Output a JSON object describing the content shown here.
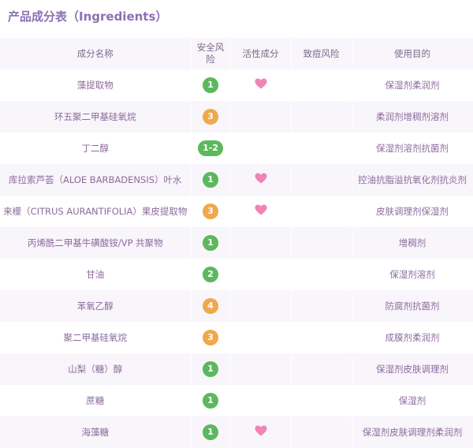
{
  "title": "产品成分表（Ingredients）",
  "colors": {
    "green": "#5cb85c",
    "orange": "#efa84b",
    "heart": "#ef85b4"
  },
  "headers": [
    "成分名称",
    "安全风险",
    "活性成分",
    "致痘风险",
    "使用目的"
  ],
  "rows": [
    {
      "name": "藻提取物",
      "safety": "1",
      "level": "green",
      "active": true,
      "acne": "",
      "purpose": "保湿剂柔润剂"
    },
    {
      "name": "环五聚二甲基硅氧烷",
      "safety": "3",
      "level": "orange",
      "active": false,
      "acne": "",
      "purpose": "柔润剂增稠剂溶剂"
    },
    {
      "name": "丁二醇",
      "safety": "1-2",
      "level": "green",
      "active": false,
      "acne": "",
      "purpose": "保湿剂溶剂抗菌剂"
    },
    {
      "name": "库拉索芦荟（ALOE BARBADENSIS）叶水",
      "safety": "1",
      "level": "green",
      "active": true,
      "acne": "",
      "purpose": "控油抗脂溢抗氧化剂抗炎剂"
    },
    {
      "name": "来檬（CITRUS AURANTIFOLIA）果皮提取物",
      "safety": "3",
      "level": "orange",
      "active": true,
      "acne": "",
      "purpose": "皮肤调理剂保湿剂"
    },
    {
      "name": "丙烯酰二甲基牛磺酸铵/VP 共聚物",
      "safety": "1",
      "level": "green",
      "active": false,
      "acne": "",
      "purpose": "增稠剂"
    },
    {
      "name": "甘油",
      "safety": "2",
      "level": "green",
      "active": false,
      "acne": "",
      "purpose": "保湿剂溶剂"
    },
    {
      "name": "苯氧乙醇",
      "safety": "4",
      "level": "orange",
      "active": false,
      "acne": "",
      "purpose": "防腐剂抗菌剂"
    },
    {
      "name": "聚二甲基硅氧烷",
      "safety": "3",
      "level": "orange",
      "active": false,
      "acne": "",
      "purpose": "成膜剂柔润剂"
    },
    {
      "name": "山梨（糖）醇",
      "safety": "1",
      "level": "green",
      "active": false,
      "acne": "",
      "purpose": "保湿剂皮肤调理剂"
    },
    {
      "name": "蔗糖",
      "safety": "1",
      "level": "green",
      "active": false,
      "acne": "",
      "purpose": "保湿剂"
    },
    {
      "name": "海藻糖",
      "safety": "1",
      "level": "green",
      "active": true,
      "acne": "",
      "purpose": "保湿剂皮肤调理剂柔润剂"
    }
  ]
}
